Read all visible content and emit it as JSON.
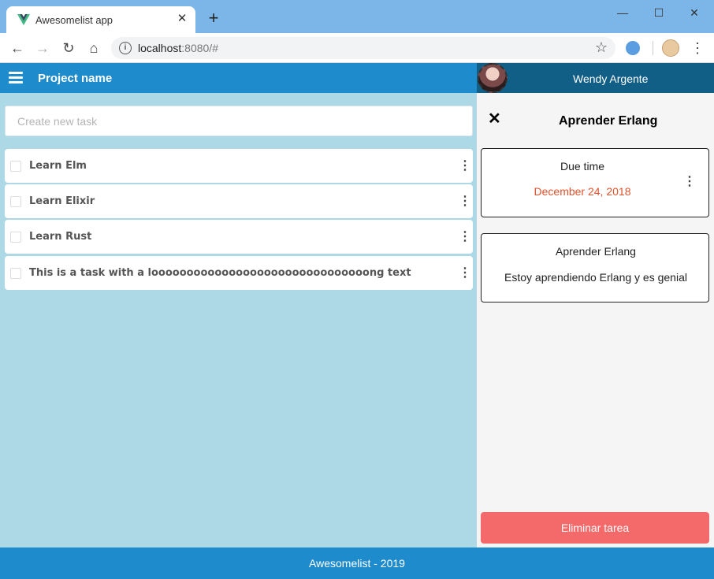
{
  "browser": {
    "tab_title": "Awesomelist app",
    "tab_close": "✕",
    "new_tab": "+",
    "url_host": "localhost",
    "url_rest": ":8080/#",
    "window_controls": {
      "minimize": "—",
      "maximize": "☐",
      "close": "✕"
    },
    "nav": {
      "back": "←",
      "forward": "→",
      "reload": "↻",
      "home": "⌂"
    },
    "bookmark_icon": "star-icon",
    "menu_icon": "⋮"
  },
  "app": {
    "project_name": "Project name",
    "new_task_placeholder": "Create new task",
    "tasks": [
      {
        "label": "Learn Elm"
      },
      {
        "label": "Learn Elixir"
      },
      {
        "label": "Learn Rust"
      },
      {
        "label": "This is a task with a looooooooooooooooooooooooooooooong text"
      }
    ],
    "more_icon": "⋮"
  },
  "sidebar": {
    "user_name": "Wendy Argente",
    "close_icon": "✕",
    "title": "Aprender Erlang",
    "due_card": {
      "label": "Due time",
      "date": "December 24, 2018"
    },
    "desc_card": {
      "title": "Aprender Erlang",
      "description": "Estoy aprendiendo Erlang y es genial"
    },
    "delete_label": "Eliminar tarea"
  },
  "footer": {
    "text": "Awesomelist - 2019"
  },
  "colors": {
    "appbar": "#1e8bcd",
    "main_bg": "#add8e6",
    "sidebar_head": "#115e86",
    "date": "#e0522d",
    "delete": "#f46a6a"
  }
}
